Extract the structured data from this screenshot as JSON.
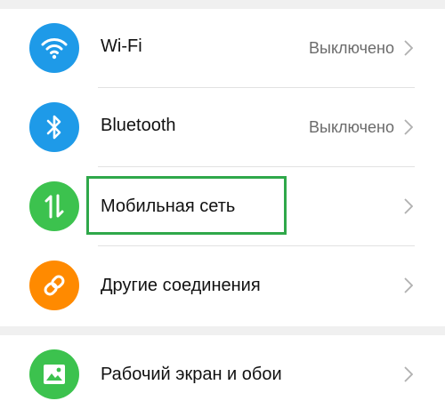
{
  "settings": {
    "items": [
      {
        "label": "Wi-Fi",
        "status": "Выключено",
        "icon": "wifi-icon",
        "color": "#1e9ae8"
      },
      {
        "label": "Bluetooth",
        "status": "Выключено",
        "icon": "bluetooth-icon",
        "color": "#1e9ae8"
      },
      {
        "label": "Мобильная сеть",
        "status": "",
        "icon": "mobile-data-icon",
        "color": "#3cc24e"
      },
      {
        "label": "Другие соединения",
        "status": "",
        "icon": "link-icon",
        "color": "#ff8a00"
      }
    ],
    "bottom_items": [
      {
        "label": "Рабочий экран и обои",
        "icon": "image-icon",
        "color": "#3cc24e"
      }
    ]
  },
  "colors": {
    "highlight": "#2fa84a",
    "blue": "#1e9ae8",
    "green": "#3cc24e",
    "orange": "#ff8a00",
    "background": "#f0f0f0"
  }
}
